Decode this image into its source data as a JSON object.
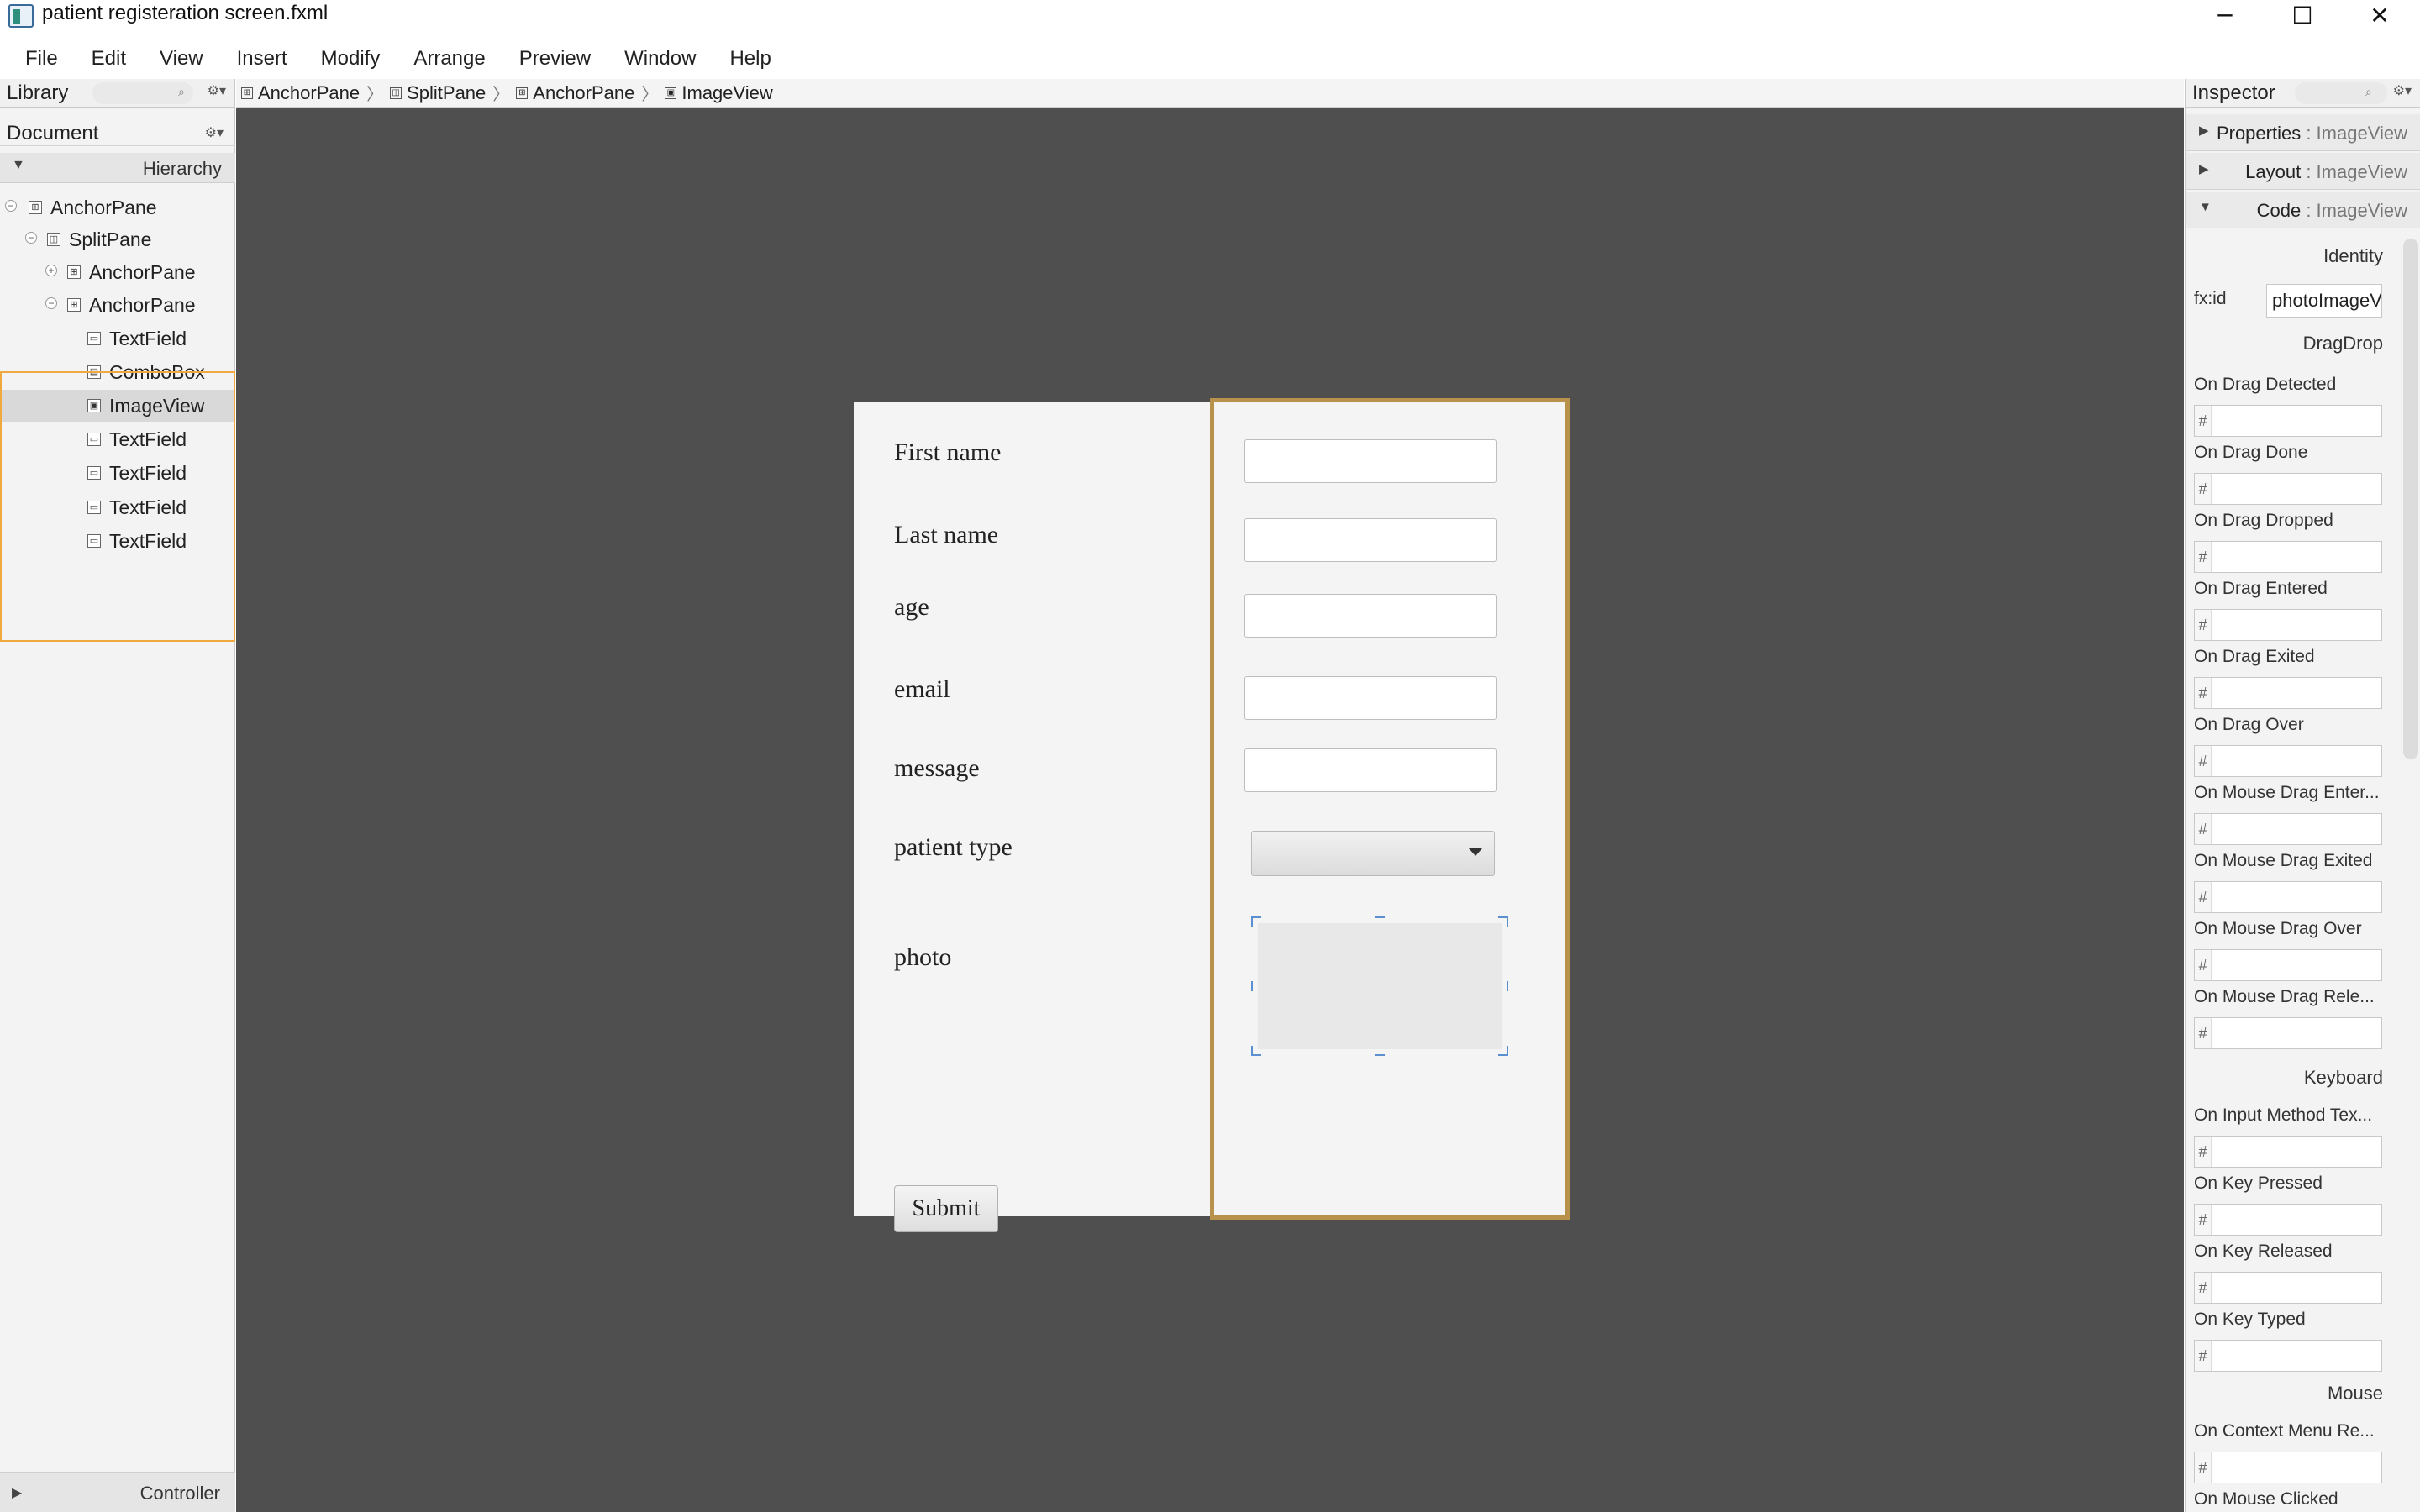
{
  "window": {
    "title": "patient registeration screen.fxml",
    "minimize_glyph": "─",
    "maximize_glyph": "☐",
    "close_glyph": "✕"
  },
  "menu": [
    "File",
    "Edit",
    "View",
    "Insert",
    "Modify",
    "Arrange",
    "Preview",
    "Window",
    "Help"
  ],
  "library": {
    "label": "Library"
  },
  "document": {
    "label": "Document",
    "hierarchy_label": "Hierarchy",
    "controller_label": "Controller"
  },
  "hierarchy": [
    {
      "name": "AnchorPane",
      "toggle": "−"
    },
    {
      "name": "SplitPane",
      "toggle": "−"
    },
    {
      "name": "AnchorPane",
      "toggle": "+"
    },
    {
      "name": "AnchorPane",
      "toggle": "−"
    },
    {
      "name": "TextField"
    },
    {
      "name": "ComboBox"
    },
    {
      "name": "ImageView"
    },
    {
      "name": "TextField"
    },
    {
      "name": "TextField"
    },
    {
      "name": "TextField"
    },
    {
      "name": "TextField"
    }
  ],
  "breadcrumb": [
    "AnchorPane",
    "SplitPane",
    "AnchorPane",
    "ImageView"
  ],
  "form": {
    "labels": [
      "First name",
      "Last name",
      "age",
      "email",
      "message",
      "patient type",
      "photo"
    ],
    "submit_label": "Submit"
  },
  "inspector": {
    "title": "Inspector",
    "sections": [
      {
        "name": "Properties",
        "sub": " : ImageView"
      },
      {
        "name": "Layout",
        "sub": " : ImageView"
      },
      {
        "name": "Code",
        "sub": " : ImageView"
      }
    ],
    "identity_label": "Identity",
    "fxid_label": "fx:id",
    "fxid_value": "photoImageV",
    "dragdrop_label": "DragDrop",
    "dragdrop_events": [
      "On Drag Detected",
      "On Drag Done",
      "On Drag Dropped",
      "On Drag Entered",
      "On Drag Exited",
      "On Drag Over",
      "On Mouse Drag Enter...",
      "On Mouse Drag Exited",
      "On Mouse Drag Over",
      "On Mouse Drag Rele..."
    ],
    "keyboard_label": "Keyboard",
    "keyboard_events": [
      "On Input Method Tex...",
      "On Key Pressed",
      "On Key Released",
      "On Key Typed"
    ],
    "mouse_label": "Mouse",
    "mouse_events": [
      "On Context Menu Re...",
      "On Mouse Clicked"
    ],
    "hash": "#"
  }
}
